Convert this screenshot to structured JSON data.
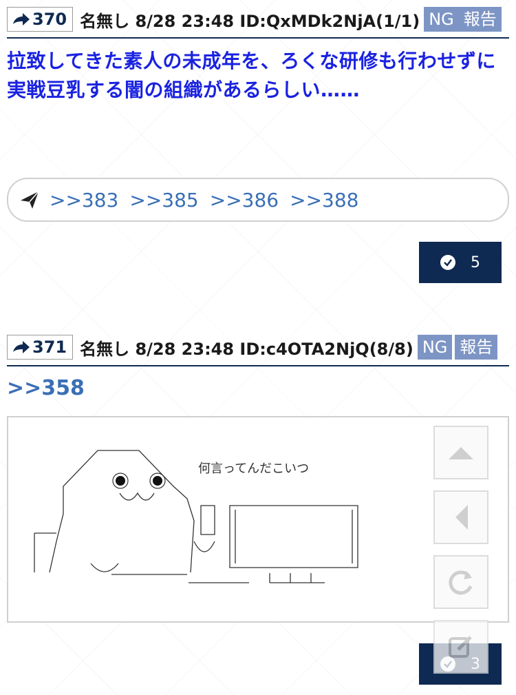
{
  "posts": [
    {
      "number": "370",
      "meta": "名無し 8/28 23:48 ID:QxMDk2NjA(1/1)",
      "ng_label": "NG",
      "report_label": "報告",
      "body": "拉致してきた素人の未成年を、ろくな研修も行わせずに実戦豆乳する闇の組織があるらしい……",
      "replies": [
        ">>383",
        ">>385",
        ">>386",
        ">>388"
      ],
      "likes": "5"
    },
    {
      "number": "371",
      "meta": "名無し 8/28 23:48 ID:c4OTA2NjQ(8/8)",
      "ng_label": "NG",
      "report_label": "報告",
      "anchor": ">>358",
      "image_caption": "何言ってんだこいつ",
      "likes": "3"
    }
  ],
  "side_buttons": [
    "scroll-up-icon",
    "back-icon",
    "reload-icon",
    "compose-icon"
  ],
  "colors": {
    "navy": "#0f2a52",
    "tag": "#7d95c4",
    "body_text": "#1a22e0",
    "link": "#3a6fb5"
  }
}
